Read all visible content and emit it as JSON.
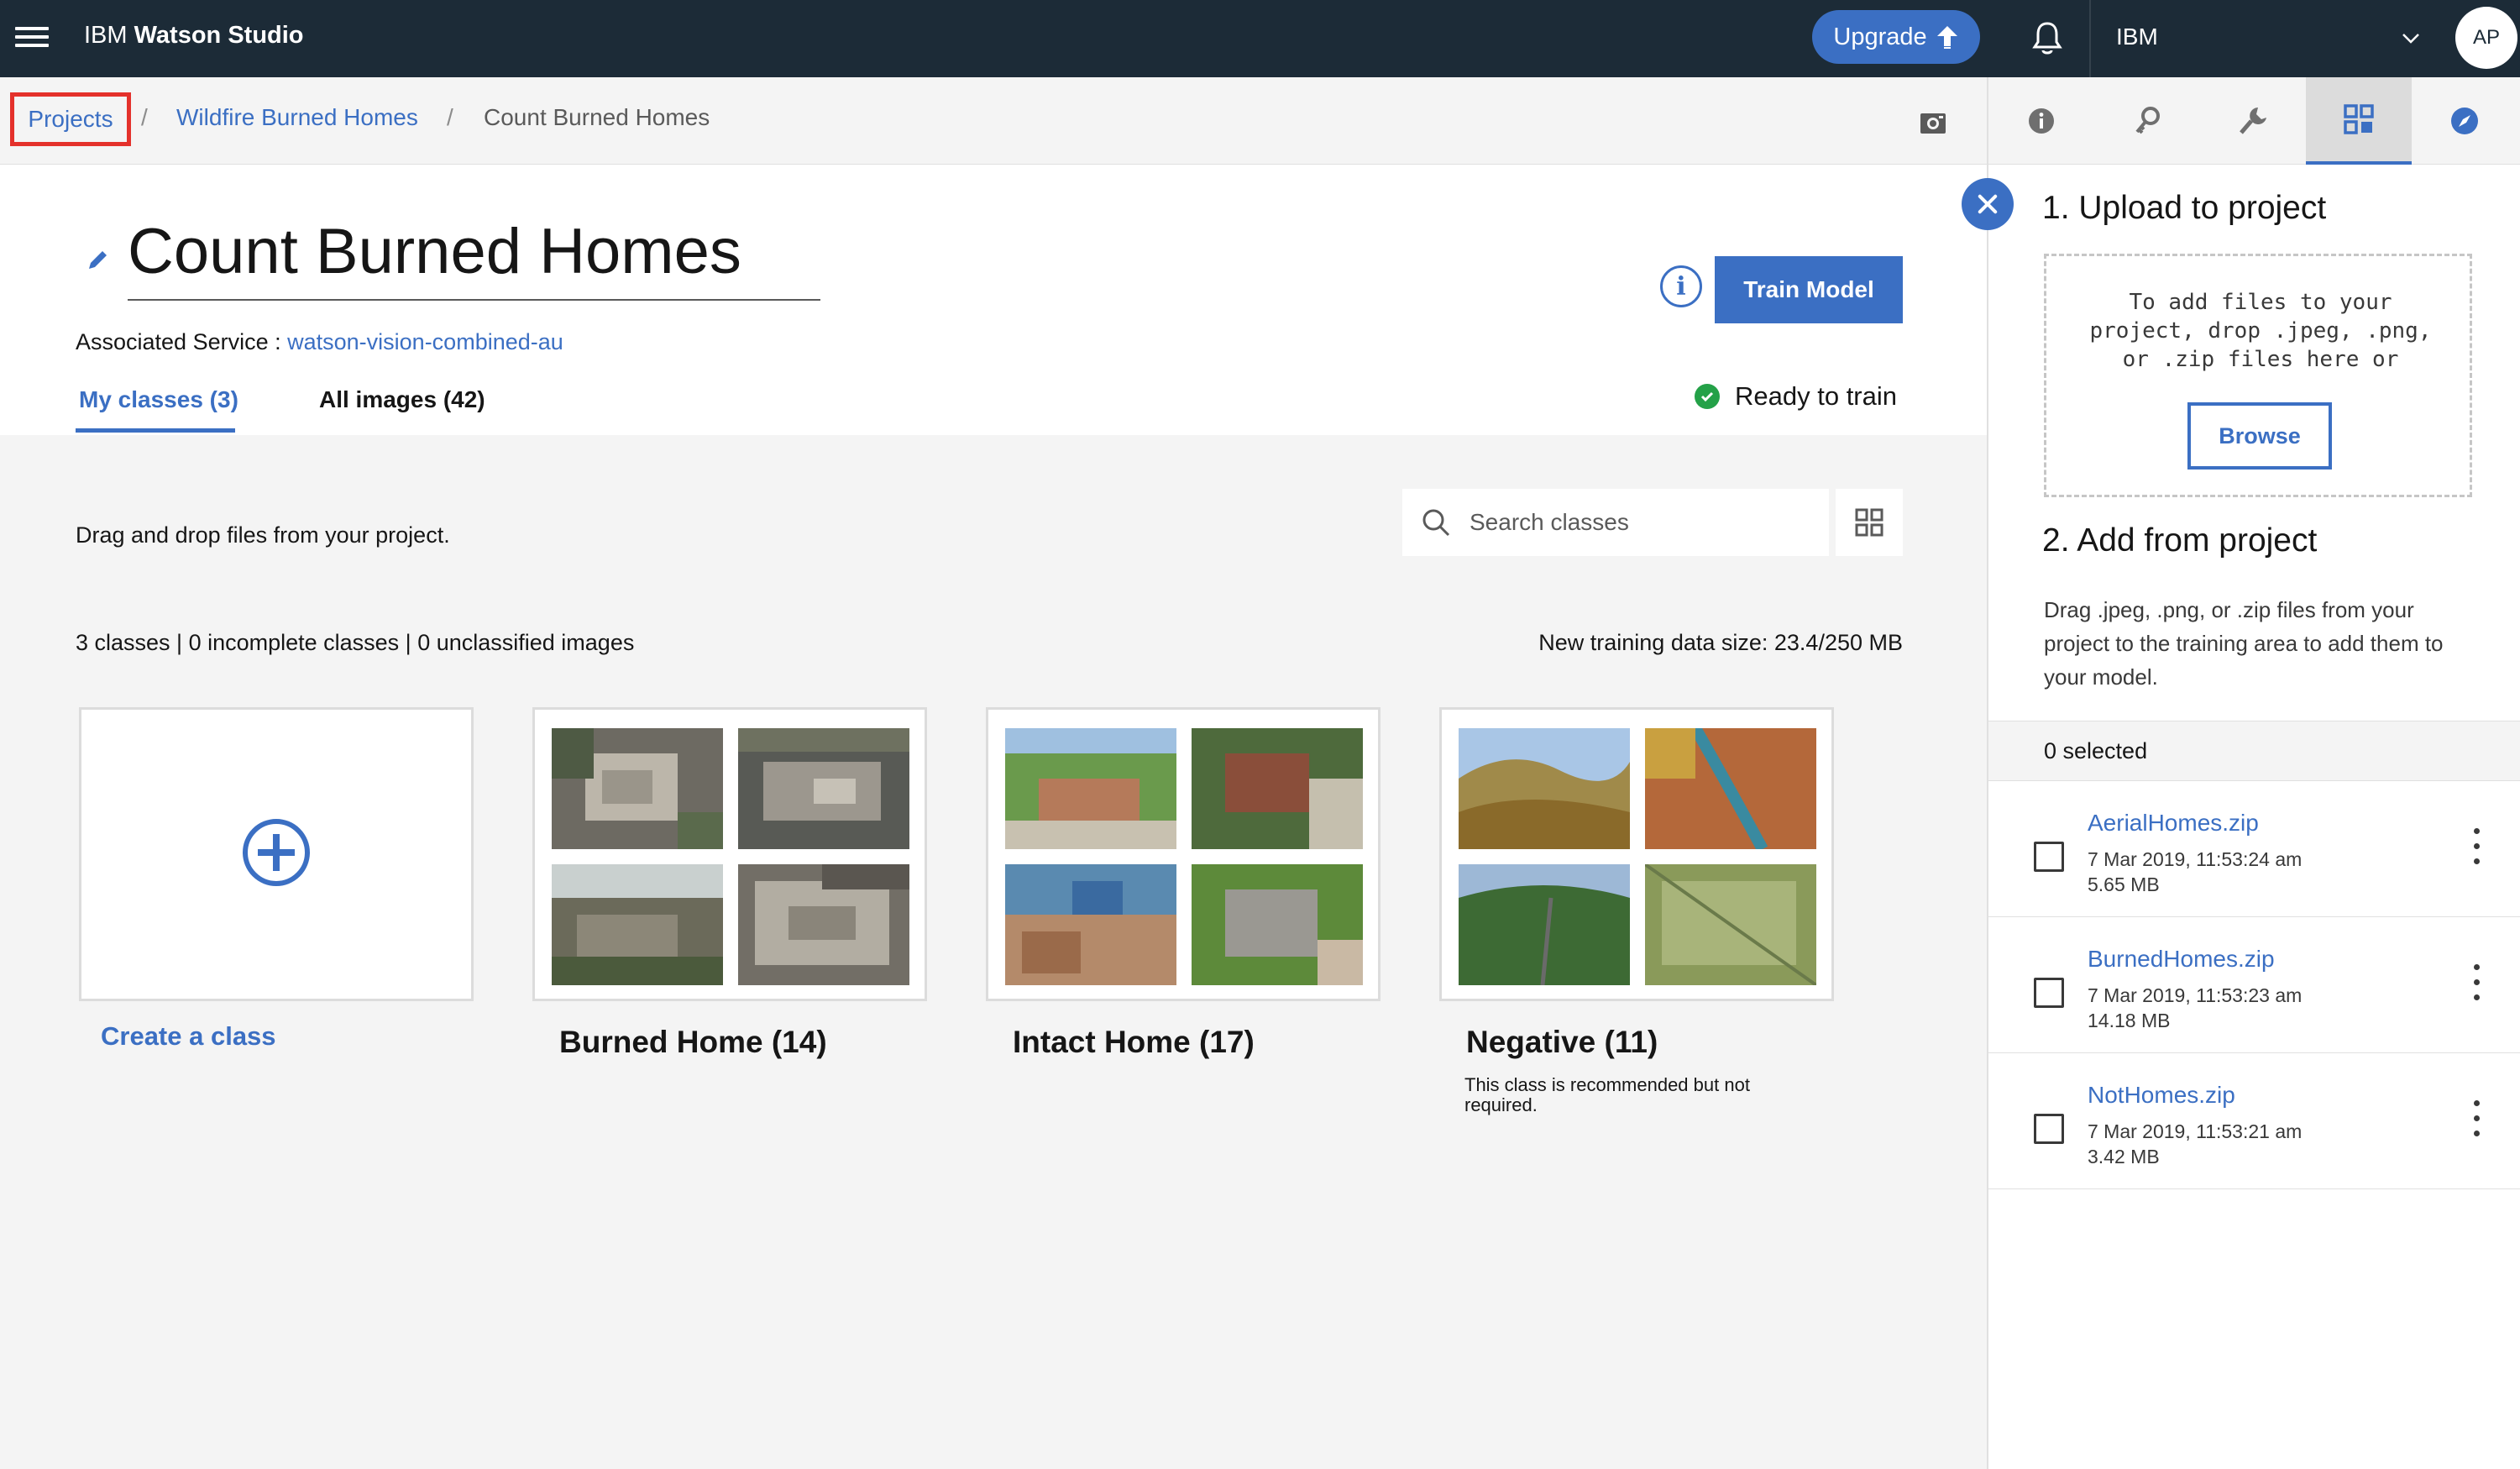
{
  "app": {
    "brand_prefix": "IBM",
    "brand_name": "Watson Studio",
    "upgrade_label": "Upgrade",
    "account_name": "IBM",
    "avatar_initials": "AP"
  },
  "breadcrumb": {
    "projects": "Projects",
    "sep1": "/",
    "project": "Wildfire Burned Homes",
    "sep2": "/",
    "current": "Count Burned Homes"
  },
  "header": {
    "title": "Count Burned Homes",
    "associated_label": "Associated Service : ",
    "associated_service": "watson-vision-combined-au",
    "info_icon": "i",
    "train_button": "Train Model",
    "tabs": [
      {
        "label": "My classes (3)",
        "active": true
      },
      {
        "label": "All images (42)",
        "active": false
      }
    ],
    "status": "Ready to train"
  },
  "content": {
    "drag_hint": "Drag and drop files from your project.",
    "search_placeholder": "Search classes",
    "stats": "3 classes | 0 incomplete classes | 0 unclassified images",
    "training_size": "New training data size: 23.4/250 MB",
    "create_label": "Create a class",
    "classes": [
      {
        "label": "Burned Home (14)",
        "note": ""
      },
      {
        "label": "Intact Home (17)",
        "note": ""
      },
      {
        "label": "Negative (11)",
        "note": "This class is recommended but not required."
      }
    ]
  },
  "panel": {
    "upload_heading": "1. Upload to project",
    "drop_text": "To add files to your project, drop .jpeg, .png, or .zip files here or",
    "browse_label": "Browse",
    "add_heading": "2. Add from project",
    "add_text": "Drag .jpeg, .png, or .zip files from your project to the training area to add them to your model.",
    "selected": "0 selected",
    "files": [
      {
        "name": "AerialHomes.zip",
        "date": "7 Mar 2019, 11:53:24 am",
        "size": "5.65 MB"
      },
      {
        "name": "BurnedHomes.zip",
        "date": "7 Mar 2019, 11:53:23 am",
        "size": "14.18 MB"
      },
      {
        "name": "NotHomes.zip",
        "date": "7 Mar 2019, 11:53:21 am",
        "size": "3.42 MB"
      }
    ]
  },
  "colors": {
    "accent": "#3b6fc3",
    "topbar": "#1c2b37",
    "success": "#24a148",
    "highlight": "#e4312b"
  },
  "icons": [
    "hamburger-icon",
    "upload-arrow-icon",
    "bell-icon",
    "chevron-down-icon",
    "camera-icon",
    "info-icon",
    "edit-icon",
    "search-icon",
    "grid-view-icon",
    "checkmark-icon",
    "close-icon",
    "plus-circle-icon",
    "overflow-menu-icon"
  ]
}
